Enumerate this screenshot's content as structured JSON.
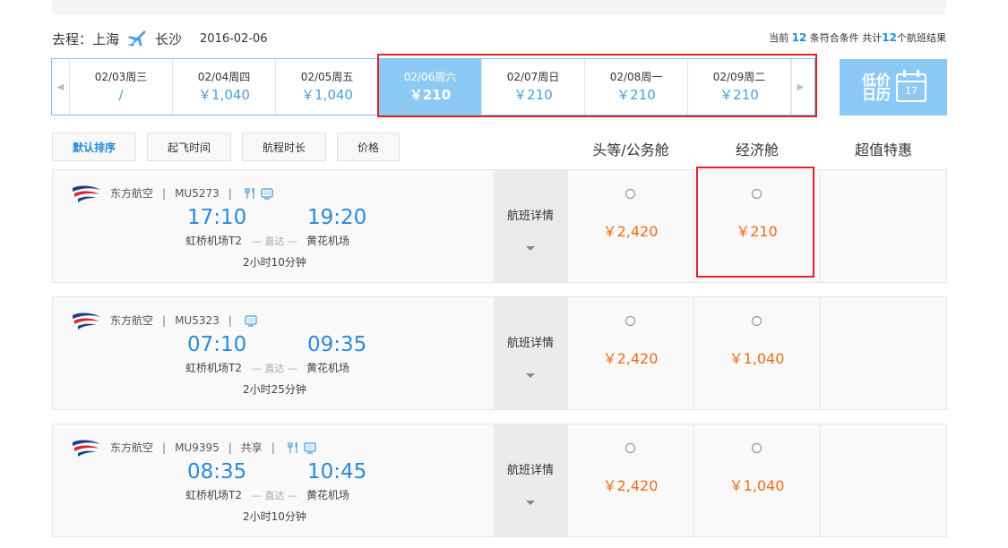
{
  "route": {
    "label": "去程：上海",
    "destination": "长沙",
    "date": "2016-02-06"
  },
  "summary": {
    "prefix": "当前",
    "current": "12",
    "middle": "条符合条件 共计",
    "total": "12",
    "suffix": "个航班结果"
  },
  "dates": [
    {
      "date": "02/03周三",
      "price": "/"
    },
    {
      "date": "02/04周四",
      "price": "￥1,040"
    },
    {
      "date": "02/05周五",
      "price": "￥1,040"
    },
    {
      "date": "02/06周六",
      "price": "￥210",
      "active": true
    },
    {
      "date": "02/07周日",
      "price": "￥210"
    },
    {
      "date": "02/08周一",
      "price": "￥210"
    },
    {
      "date": "02/09周二",
      "price": "￥210"
    }
  ],
  "calendar": {
    "label_line1": "低价",
    "label_line2": "日历",
    "day": "17"
  },
  "sort": [
    "默认排序",
    "起飞时间",
    "航程时长",
    "价格"
  ],
  "columns": {
    "first": "头等/公务舱",
    "economy": "经济舱",
    "special": "超值特惠"
  },
  "flights": [
    {
      "airline": "东方航空",
      "number": "MU5273",
      "share": "",
      "dep_time": "17:10",
      "arr_time": "19:20",
      "dep_airport": "虹桥机场T2",
      "arr_airport": "黄花机场",
      "direct": "直达",
      "duration": "2小时10分钟",
      "detail": "航班详情",
      "first_price": "￥2,420",
      "econ_price": "￥210",
      "meal": true
    },
    {
      "airline": "东方航空",
      "number": "MU5323",
      "share": "",
      "dep_time": "07:10",
      "arr_time": "09:35",
      "dep_airport": "虹桥机场T2",
      "arr_airport": "黄花机场",
      "direct": "直达",
      "duration": "2小时25分钟",
      "detail": "航班详情",
      "first_price": "￥2,420",
      "econ_price": "￥1,040",
      "meal": false
    },
    {
      "airline": "东方航空",
      "number": "MU9395",
      "share": "共享",
      "dep_time": "08:35",
      "arr_time": "10:45",
      "dep_airport": "虹桥机场T2",
      "arr_airport": "黄花机场",
      "direct": "直达",
      "duration": "2小时10分钟",
      "detail": "航班详情",
      "first_price": "￥2,420",
      "econ_price": "￥1,040",
      "meal": true
    }
  ],
  "colors": {
    "accent": "#2a8ad9",
    "active_date": "#8ccaf5",
    "price": "#f06a1a",
    "highlight": "#d9262a"
  }
}
